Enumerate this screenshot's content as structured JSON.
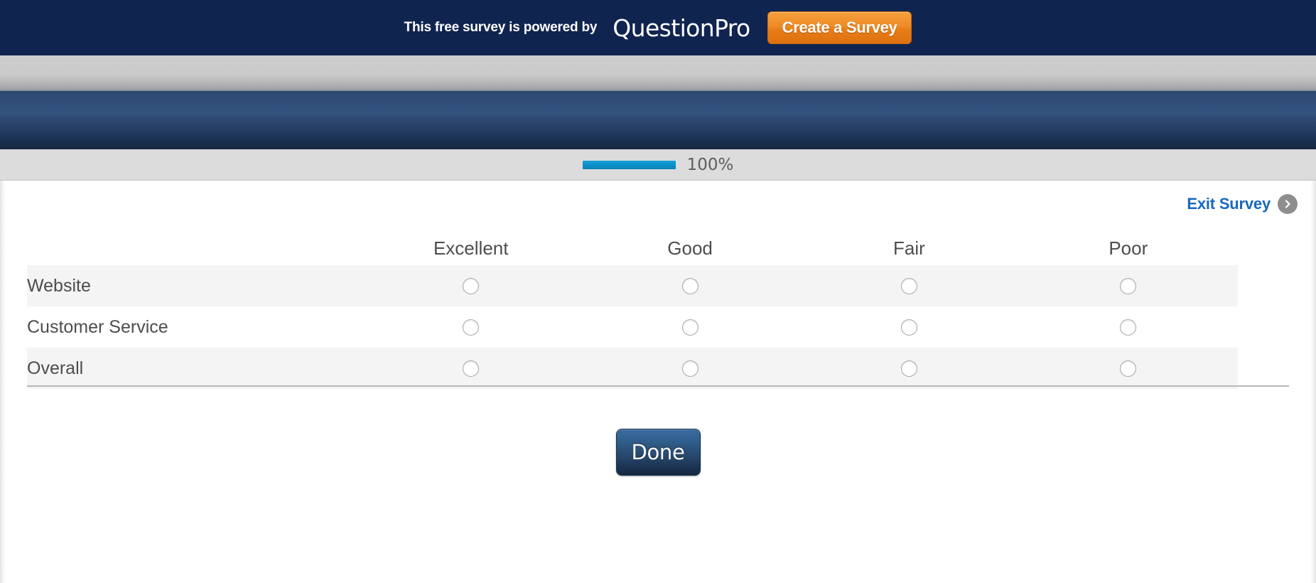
{
  "promo": {
    "text": "This free survey is powered by",
    "logo": "QuestionPro",
    "cta_label": "Create a Survey"
  },
  "progress": {
    "percent_label": "100%",
    "percent_value": 100,
    "bar_color": "#0a93cf"
  },
  "panel": {
    "exit_survey_label": "Exit Survey",
    "exit_arrow_icon": "chevron-right-icon"
  },
  "matrix": {
    "row_header": "",
    "columns": [
      "Excellent",
      "Good",
      "Fair",
      "Poor"
    ],
    "rows": [
      {
        "label": "Website",
        "selected": null
      },
      {
        "label": "Customer Service",
        "selected": null
      },
      {
        "label": "Overall",
        "selected": null
      }
    ]
  },
  "actions": {
    "done_label": "Done"
  },
  "colors": {
    "promo_bar": "#102450",
    "promo_cta": "#ef8c27",
    "survey_band": "#2d4871",
    "progress_strip": "#dcdcdc",
    "link_blue": "#1668c1",
    "stripe": "#f4f4f4",
    "text_gray": "#4d4d4d"
  }
}
